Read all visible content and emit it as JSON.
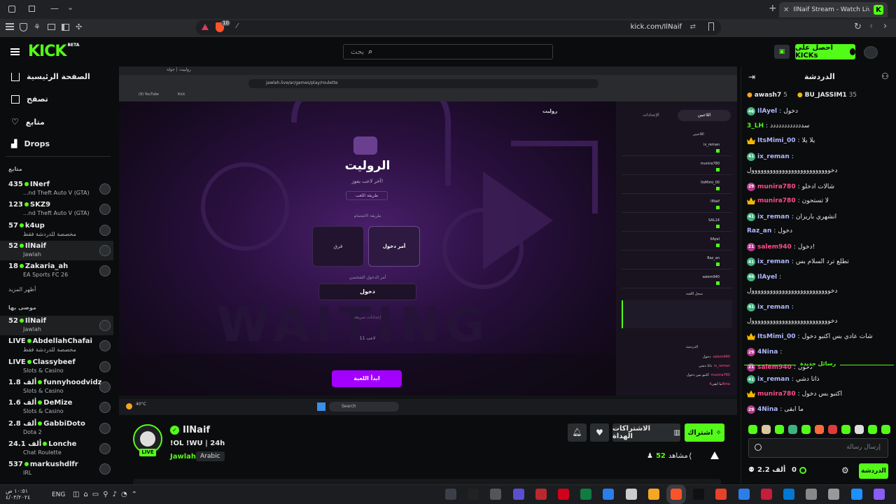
{
  "browser": {
    "tab_title": "IlNaif Stream - Watch Live on",
    "url": "kick.com/IlNaif",
    "shield_count": "10"
  },
  "header": {
    "search_placeholder": "بحث",
    "get_kicks": "احصل على KICKs"
  },
  "sidebar": {
    "nav": [
      {
        "label": "الصفحة الرئيسية",
        "icon": "home-icon"
      },
      {
        "label": "تصفح",
        "icon": "browse-icon"
      },
      {
        "label": "متابع",
        "icon": "heart-icon"
      },
      {
        "label": "Drops",
        "icon": "drops-icon"
      }
    ],
    "following_title": "متابع",
    "following": [
      {
        "viewers": "435",
        "name": "INerf",
        "category": "...nd Theft Auto V (GTA)"
      },
      {
        "viewers": "123",
        "name": "SKZ9",
        "category": "...nd Theft Auto V (GTA)"
      },
      {
        "viewers": "57",
        "name": "k4up",
        "category": "مخصصة للدردشة فقط"
      },
      {
        "viewers": "52",
        "name": "IlNaif",
        "category": "Jawlah"
      },
      {
        "viewers": "18",
        "name": "Zakaria_ah",
        "category": "EA Sports FC 26"
      }
    ],
    "show_more": "أظهر المزيد",
    "recommended_title": "موصى بها",
    "recommended": [
      {
        "viewers": "52",
        "name": "IlNaif",
        "category": "Jawlah"
      },
      {
        "viewers": "LIVE",
        "name": "AbdellahChafai",
        "category": "مخصصة للدردشة فقط"
      },
      {
        "viewers": "LIVE",
        "name": "Classybeef",
        "category": "Slots & Casino"
      },
      {
        "viewers": "1.8 ألف",
        "name": "funnyhoodvidz",
        "category": "Slots & Casino"
      },
      {
        "viewers": "1.6 ألف",
        "name": "DeMize",
        "category": "Slots & Casino"
      },
      {
        "viewers": "2.8 ألف",
        "name": "GabbiDoto",
        "category": "Dota 2"
      },
      {
        "viewers": "24.1 ألف",
        "name": "Lonche",
        "category": "Chat Roulette"
      },
      {
        "viewers": "537",
        "name": "markushdlfr",
        "category": "IRL"
      }
    ]
  },
  "video": {
    "inner_url": "jawlah.live/ar/games/play/roulette",
    "inner_tab": "رولييت | جولة",
    "bookmarks": [
      "(9) YouTube",
      "Kick"
    ],
    "game_title": "الروليت",
    "game_subtitle": "آخر لاعب يفوز!",
    "how_to_play": "طريقة اللعب",
    "entry_method": "طريقة الاشتمام",
    "option1_title": "أمر دخول",
    "option2_title": "فرق",
    "entry_command_label": "أمر الدخول الشخصي",
    "entry_command": "دخول",
    "quick_settings": "إعدادات سريعة",
    "players_count": "11 لاعب",
    "start_button": "ابدأ اللعبة",
    "waiting": "WAITING",
    "top_tab_players": "اللاعبين",
    "top_tab_settings": "الإعدادات",
    "roulette_label": "روليت",
    "players_section": "اللاعبين",
    "log_section": "سجل اللعبة",
    "chat_section": "الدردشة",
    "players": [
      "ix_reman",
      "munira780",
      "ItsMimi_00",
      "IlNaif",
      "SAL14",
      "IlAyel",
      "Raz_an",
      "salem940"
    ],
    "inner_chat": [
      {
        "user": "salem940",
        "text": "دخول"
      },
      {
        "user": "ix_reman",
        "text": "ذاتا دشي"
      },
      {
        "user": "munira780",
        "text": "اكتبو بس دخول"
      },
      {
        "user": "4Nina",
        "text": "ما ابقى"
      }
    ],
    "taskbar_weather": "40°C",
    "taskbar_search": "Search"
  },
  "stream": {
    "name": "IlNaif",
    "title": "!OL !WU | 24h",
    "category": "Jawlah",
    "language": "Arabic",
    "live_badge": "LIVE",
    "viewers": "52",
    "viewers_label": "مشاهد",
    "subscribe": "اشتراك",
    "gift_subs": "الاشتراكات الهداة"
  },
  "chat": {
    "title": "الدردشة",
    "leaders": [
      {
        "name": "awash7",
        "count": "5"
      },
      {
        "name": "BU_JASSIM1",
        "count": "35"
      }
    ],
    "messages": [
      {
        "badge": "46",
        "user": "IlAyel",
        "text": "دخول",
        "color": "#aeb8ff"
      },
      {
        "badge": "",
        "user": "3_LH",
        "text": "سدددددددددددد",
        "color": "#53fc18"
      },
      {
        "badge": "crown",
        "user": "ItsMimi_00",
        "text": "يلا يلا",
        "color": "#aeb8ff"
      },
      {
        "badge": "41",
        "user": "ix_reman",
        "text": "",
        "color": "#aeb8ff"
      },
      {
        "badge": "",
        "user": "",
        "text": "دخوووووووووووووووووووووووووول",
        "color": ""
      },
      {
        "badge": "29",
        "user": "munira780",
        "text": "شالات ادخلو",
        "color": "#ff4d8a"
      },
      {
        "badge": "crown",
        "user": "munira780",
        "text": "لا تستحون",
        "color": "#ff4d8a"
      },
      {
        "badge": "41",
        "user": "ix_reman",
        "text": "انشهري باريزان",
        "color": "#aeb8ff"
      },
      {
        "badge": "",
        "user": "Raz_an",
        "text": "دخول",
        "color": "#aeb8ff"
      },
      {
        "badge": "21",
        "user": "salem940",
        "text": "دخول!",
        "color": "#ff4d8a"
      },
      {
        "badge": "41",
        "user": "ix_reman",
        "text": "تطلع ترد السلام بس",
        "color": "#aeb8ff"
      },
      {
        "badge": "46",
        "user": "IlAyel",
        "text": "",
        "color": "#aeb8ff"
      },
      {
        "badge": "",
        "user": "",
        "text": "دخوووووووووووووووووووووووووول",
        "color": ""
      },
      {
        "badge": "41",
        "user": "ix_reman",
        "text": "",
        "color": "#aeb8ff"
      },
      {
        "badge": "",
        "user": "",
        "text": "دخوووووووووووووووووووووووووول",
        "color": ""
      },
      {
        "badge": "crown",
        "user": "ItsMimi_00",
        "text": "شات عادي بس اكتبو دخول",
        "color": "#aeb8ff"
      },
      {
        "badge": "29",
        "user": "4Nina",
        "text": "",
        "color": "#aeb8ff"
      },
      {
        "badge": "21",
        "user": "salem940",
        "text": "دخول",
        "color": "#ff4d8a"
      }
    ],
    "new_messages": "رسائل جديدة",
    "new": [
      {
        "badge": "41",
        "user": "ix_reman",
        "text": "ذاتا دشي",
        "color": "#aeb8ff"
      },
      {
        "badge": "crown",
        "user": "munira780",
        "text": "اكتبو بس دخول",
        "color": "#ff4d8a"
      },
      {
        "badge": "29",
        "user": "4Nina",
        "text": "ما ابقى",
        "color": "#aeb8ff"
      }
    ],
    "input_placeholder": "إرسال رسالة",
    "points": "2.2 ألف",
    "kicks": "0",
    "send_label": "الدردشة"
  },
  "taskbar": {
    "lang": "ENG",
    "time": "١٠:٥١ ص",
    "date": "٤/٠٣/٢٠٢٤"
  },
  "colors": {
    "accent": "#53fc18",
    "start_button": "#a300ff"
  }
}
